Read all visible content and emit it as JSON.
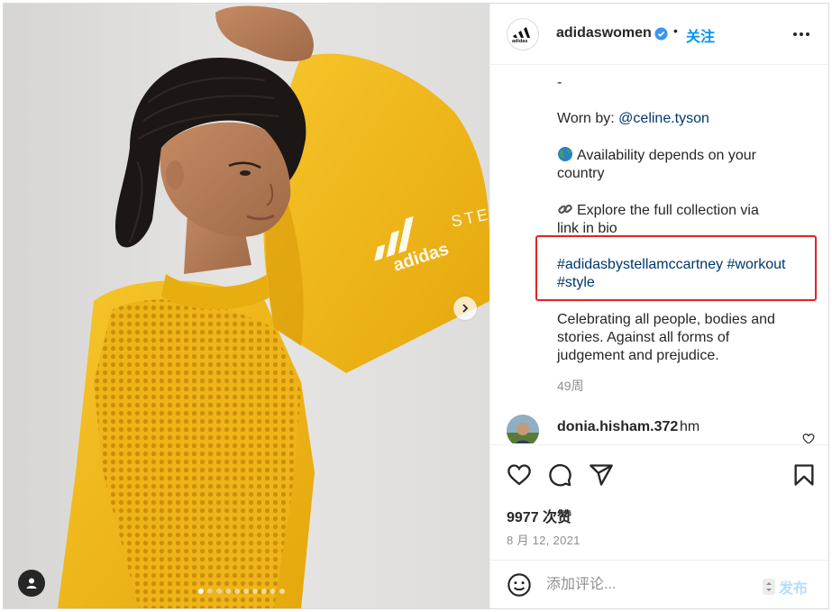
{
  "post": {
    "media": {
      "image_alt": "Woman in yellow adidas sweatshirt with mesh panel",
      "carousel_dot_count": 10,
      "active_dot_index": 0,
      "sleeve_text": "STE"
    },
    "header": {
      "username": "adidaswomen",
      "separator": "•",
      "follow_label": "关注"
    },
    "caption": {
      "dash": "-",
      "worn_by_prefix": "Worn by: ",
      "worn_by_handle": "@celine.tyson",
      "availability_line1": "Availability depends on your",
      "availability_line2": "country",
      "explore_line1": "Explore the full collection via",
      "explore_line2": "link in bio",
      "hashtag_line1": "#adidasbystellamccartney #workout",
      "hashtag_line2": "#style",
      "body_line1": "Celebrating all people, bodies and",
      "body_line2": "stories. Against all forms of",
      "body_line3": "judgement and prejudice.",
      "time_ago": "49周"
    },
    "comment": {
      "username": "donia.hisham.372",
      "text": "hm"
    },
    "stats": {
      "likes": "9977 次赞",
      "date": "8 月 12, 2021"
    },
    "comment_input": {
      "placeholder": "添加评论...",
      "post_label": "发布"
    },
    "colors": {
      "accent": "#0095f6",
      "highlight": "#e02424",
      "sweater": "#f0b512"
    }
  }
}
